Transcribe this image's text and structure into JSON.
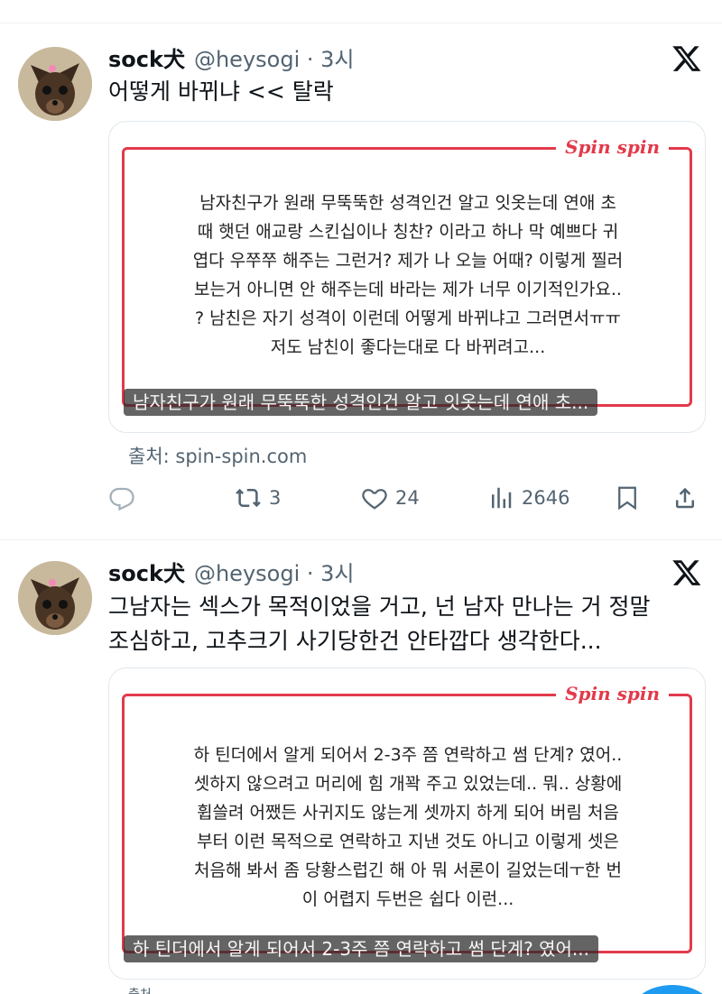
{
  "tweets": [
    {
      "name": "sock犬",
      "handle": "@heysogi · 3시",
      "text": "어떻게 바뀌냐 << 탈락",
      "card": {
        "brand": "Spin spin",
        "text": "남자친구가 원래 무뚝뚝한 성격인건 알고 잇옷는데 연애 초\n때 햇던 애교랑 스킨십이나 칭찬? 이라고 하나 막 예쁘다 귀\n엽다 우쭈쭈 해주는 그런거? 제가 나 오늘 어때? 이렇게 찔러\n보는거 아니면 안 해주는데 바라는 제가 너무 이기적인가요..\n? 남친은 자기 성격이 이런데 어떻게 바뀌냐고 그러면서ㅠㅠ\n저도 남친이 좋다는대로 다 바뀌려고...",
        "caption": "남자친구가 원래 무뚝뚝한 성격인건 알고 잇옷는데 연애 초..."
      },
      "source": "출처: spin-spin.com",
      "actions": {
        "retweets": "3",
        "likes": "24",
        "views": "2646"
      }
    },
    {
      "name": "sock犬",
      "handle": "@heysogi · 3시",
      "text": "그남자는 섹스가 목적이었을 거고, 넌 남자 만나는 거 정말\n조심하고, 고추크기 사기당한건 안타깝다 생각한다...",
      "card": {
        "brand": "Spin spin",
        "text": "하 틴더에서 알게 되어서 2-3주 쯤 연락하고 썸 단계? 였어..\n셋하지 않으려고 머리에 힘 개꽉 주고 있었는데.. 뭐.. 상황에\n휩쓸려 어쨌든 사귀지도 않는게 셋까지 하게 되어 버림 처음\n부터 이런 목적으로 연락하고 지낸 것도 아니고 이렇게 셋은\n처음해 봐서 좀 당황스럽긴 해 아 뭐 서론이 길었는데ㅜ한 번\n이 어렵지 두번은 쉽다 이런...",
        "caption": "하 틴더에서 알게 되어서 2-3주 쯤 연락하고 썸 단계? 였어..."
      },
      "source": "출처",
      "actions": {}
    }
  ]
}
